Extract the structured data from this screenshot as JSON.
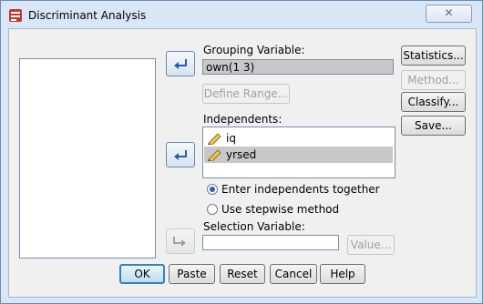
{
  "window": {
    "title": "Discriminant Analysis",
    "close_glyph": "✕"
  },
  "grouping": {
    "label": "Grouping Variable:",
    "value": "own(1 3)",
    "define_range_label": "Define Range..."
  },
  "independents": {
    "label": "Independents:",
    "items": [
      {
        "label": "iq"
      },
      {
        "label": "yrsed"
      }
    ]
  },
  "methods": {
    "enter_together": "Enter independents together",
    "stepwise": "Use stepwise method",
    "selected": "enter_together"
  },
  "selection": {
    "label": "Selection Variable:",
    "value": "",
    "value_button_label": "Value..."
  },
  "side_buttons": {
    "statistics": "Statistics...",
    "method": "Method...",
    "classify": "Classify...",
    "save": "Save..."
  },
  "bottom_buttons": {
    "ok": "OK",
    "paste": "Paste",
    "reset": "Reset",
    "cancel": "Cancel",
    "help": "Help"
  },
  "icons": {
    "move": "arrow-left-icon",
    "move_disabled": "arrow-right-icon",
    "variable": "pencil-ruler-icon"
  },
  "colors": {
    "accent": "#2a5ea8",
    "selection": "#c8c8c8"
  }
}
